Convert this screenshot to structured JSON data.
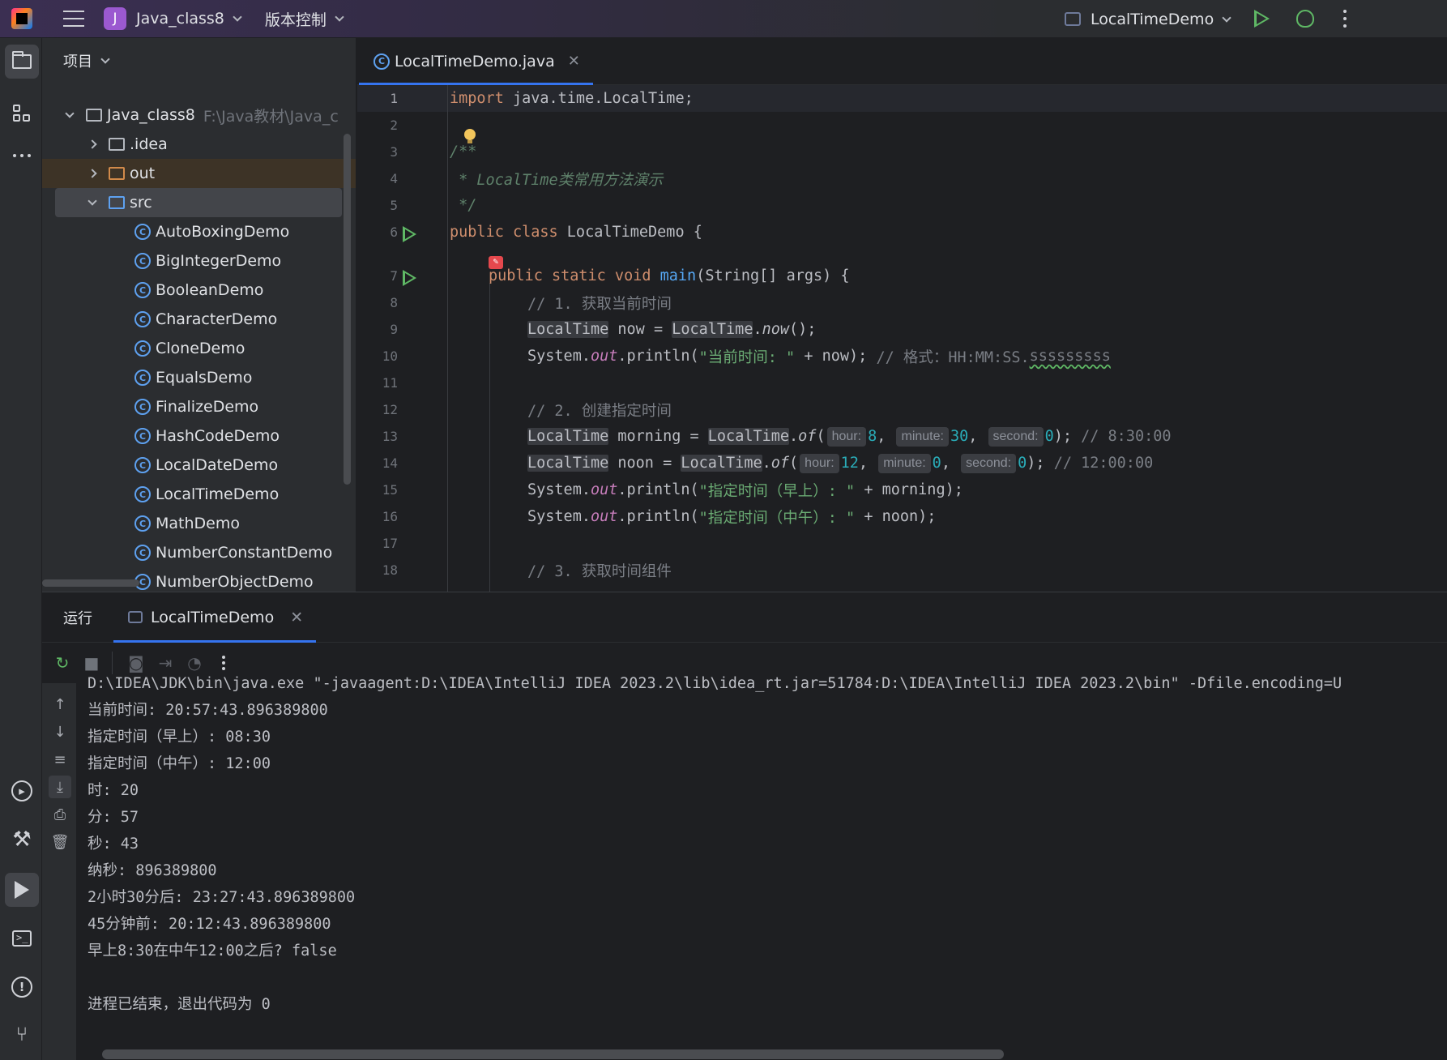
{
  "titlebar": {
    "project_initial": "J",
    "project_name": "Java_class8",
    "vcs_label": "版本控制",
    "run_config": "LocalTimeDemo"
  },
  "project_panel": {
    "title": "项目",
    "root": {
      "name": "Java_class8",
      "path": "F:\\Java教材\\Java_c"
    },
    "folders": [
      ".idea",
      "out",
      "src"
    ],
    "classes": [
      "AutoBoxingDemo",
      "BigIntegerDemo",
      "BooleanDemo",
      "CharacterDemo",
      "CloneDemo",
      "EqualsDemo",
      "FinalizeDemo",
      "HashCodeDemo",
      "LocalDateDemo",
      "LocalTimeDemo",
      "MathDemo",
      "NumberConstantDemo",
      "NumberObjectDemo"
    ]
  },
  "editor": {
    "tab_label": "LocalTimeDemo.java",
    "line_numbers": [
      "1",
      "2",
      "3",
      "4",
      "5",
      "6",
      "7",
      "8",
      "9",
      "10",
      "11",
      "12",
      "13",
      "14",
      "15",
      "16",
      "17",
      "18"
    ],
    "code": {
      "l1_kw": "import",
      "l1_rest": " java.time.LocalTime;",
      "l3": "/**",
      "l4": " * LocalTime类常用方法演示",
      "l5": " */",
      "l6_kw": "public class",
      "l6_rest": " LocalTimeDemo {",
      "l7_kw": "public static void",
      "l7_fn": "main",
      "l7_rest": "(String[] args) {",
      "l8": "// 1. 获取当前时间",
      "l9_t": "LocalTime",
      "l9_a": " now = ",
      "l9_b": "LocalTime",
      "l9_c": ".",
      "l9_d": "now",
      "l9_e": "();",
      "l10_a": "System.",
      "l10_out": "out",
      "l10_b": ".println(",
      "l10_str": "\"当前时间: \"",
      "l10_c": " + now); ",
      "l10_cmt": "// 格式：HH:MM:SS.",
      "l10_sq": "sssssssss",
      "l12": "// 2. 创建指定时间",
      "l13_t": "LocalTime",
      "l13_a": " morning = ",
      "l13_b": "LocalTime",
      "l13_of": "of",
      "l13_h": "hour:",
      "l13_hv": "8",
      "l13_m": "minute:",
      "l13_mv": "30",
      "l13_s": "second:",
      "l13_sv": "0",
      "l13_cmt": "// 8:30:00",
      "l14_t": "LocalTime",
      "l14_a": " noon = ",
      "l14_b": "LocalTime",
      "l14_of": "of",
      "l14_h": "hour:",
      "l14_hv": "12",
      "l14_m": "minute:",
      "l14_mv": "0",
      "l14_s": "second:",
      "l14_sv": "0",
      "l14_cmt": "// 12:00:00",
      "l15_a": "System.",
      "l15_out": "out",
      "l15_b": ".println(",
      "l15_str": "\"指定时间（早上）: \"",
      "l15_c": " + morning);",
      "l16_a": "System.",
      "l16_out": "out",
      "l16_b": ".println(",
      "l16_str": "\"指定时间（中午）: \"",
      "l16_c": " + noon);",
      "l18": "// 3. 获取时间组件"
    }
  },
  "run_panel": {
    "title": "运行",
    "tab_label": "LocalTimeDemo",
    "console_lines": [
      "D:\\IDEA\\JDK\\bin\\java.exe \"-javaagent:D:\\IDEA\\IntelliJ IDEA 2023.2\\lib\\idea_rt.jar=51784:D:\\IDEA\\IntelliJ IDEA 2023.2\\bin\" -Dfile.encoding=U",
      "当前时间: 20:57:43.896389800",
      "指定时间（早上）: 08:30",
      "指定时间（中午）: 12:00",
      "时: 20",
      "分: 57",
      "秒: 43",
      "纳秒: 896389800",
      "2小时30分后: 23:27:43.896389800",
      "45分钟前: 20:12:43.896389800",
      "早上8:30在中午12:00之后? false",
      "",
      "进程已结束，退出代码为 0"
    ]
  },
  "icons": {
    "colors": {
      "run_green": "#5fb865",
      "accent_blue": "#3574f0",
      "class_icon": "#5ea1f0"
    }
  }
}
